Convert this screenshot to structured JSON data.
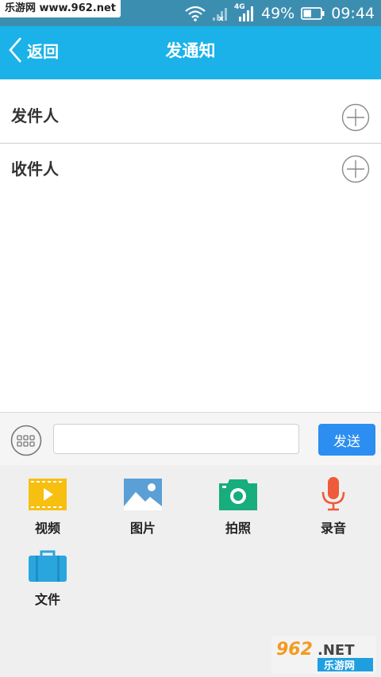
{
  "status_bar": {
    "watermark": "乐游网 www.962.net",
    "network": "4G",
    "battery": "49%",
    "time": "09:44"
  },
  "header": {
    "back_label": "返回",
    "title": "发通知"
  },
  "fields": {
    "sender_label": "发件人",
    "recipient_label": "收件人"
  },
  "input_bar": {
    "value": "",
    "placeholder": "",
    "send_label": "发送"
  },
  "tools": [
    {
      "label": "视频",
      "icon": "video-icon",
      "color": "#f7bf10"
    },
    {
      "label": "图片",
      "icon": "image-icon",
      "color": "#5a9fd6"
    },
    {
      "label": "拍照",
      "icon": "camera-icon",
      "color": "#17ad7c"
    },
    {
      "label": "录音",
      "icon": "microphone-icon",
      "color": "#ee5b3a"
    },
    {
      "label": "文件",
      "icon": "briefcase-icon",
      "color": "#2aa6df"
    }
  ],
  "colors": {
    "status_bar": "#3c8eb1",
    "title_bar": "#1ab2e8",
    "send_button": "#2b8ef0"
  },
  "bottom_watermark": {
    "line1": "962.NET",
    "line2": "乐游网"
  }
}
